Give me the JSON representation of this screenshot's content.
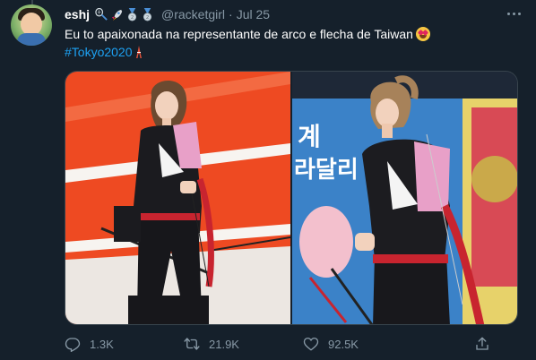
{
  "author": {
    "name": "eshj",
    "handle": "@racketgirl",
    "time": "Jul 25",
    "badge_icons": [
      "badminton-racket-icon",
      "rocket-icon",
      "silver-medal-icon",
      "silver-medal-icon"
    ]
  },
  "tweet": {
    "text": "Eu to apaixonada na representante de arco e flecha de Taiwan",
    "emoji": "heart-eyes-emoji-icon",
    "hashtag": "#Tokyo2020",
    "hashtag_emoji": "tokyo-tower-icon"
  },
  "media": {
    "left_photo": {
      "subject": "archer in black uniform with pink chest guard on orange field"
    },
    "right_photo": {
      "subject": "archer holding red bow in front of blue banner"
    },
    "right_banner_text": [
      "계",
      "라달리"
    ]
  },
  "actions": {
    "reply_count": "1.3K",
    "retweet_count": "21.9K",
    "like_count": "92.5K"
  },
  "colors": {
    "background": "#15202b",
    "text_secondary": "#8899a6",
    "link": "#1da1f2",
    "border": "#38444d"
  }
}
